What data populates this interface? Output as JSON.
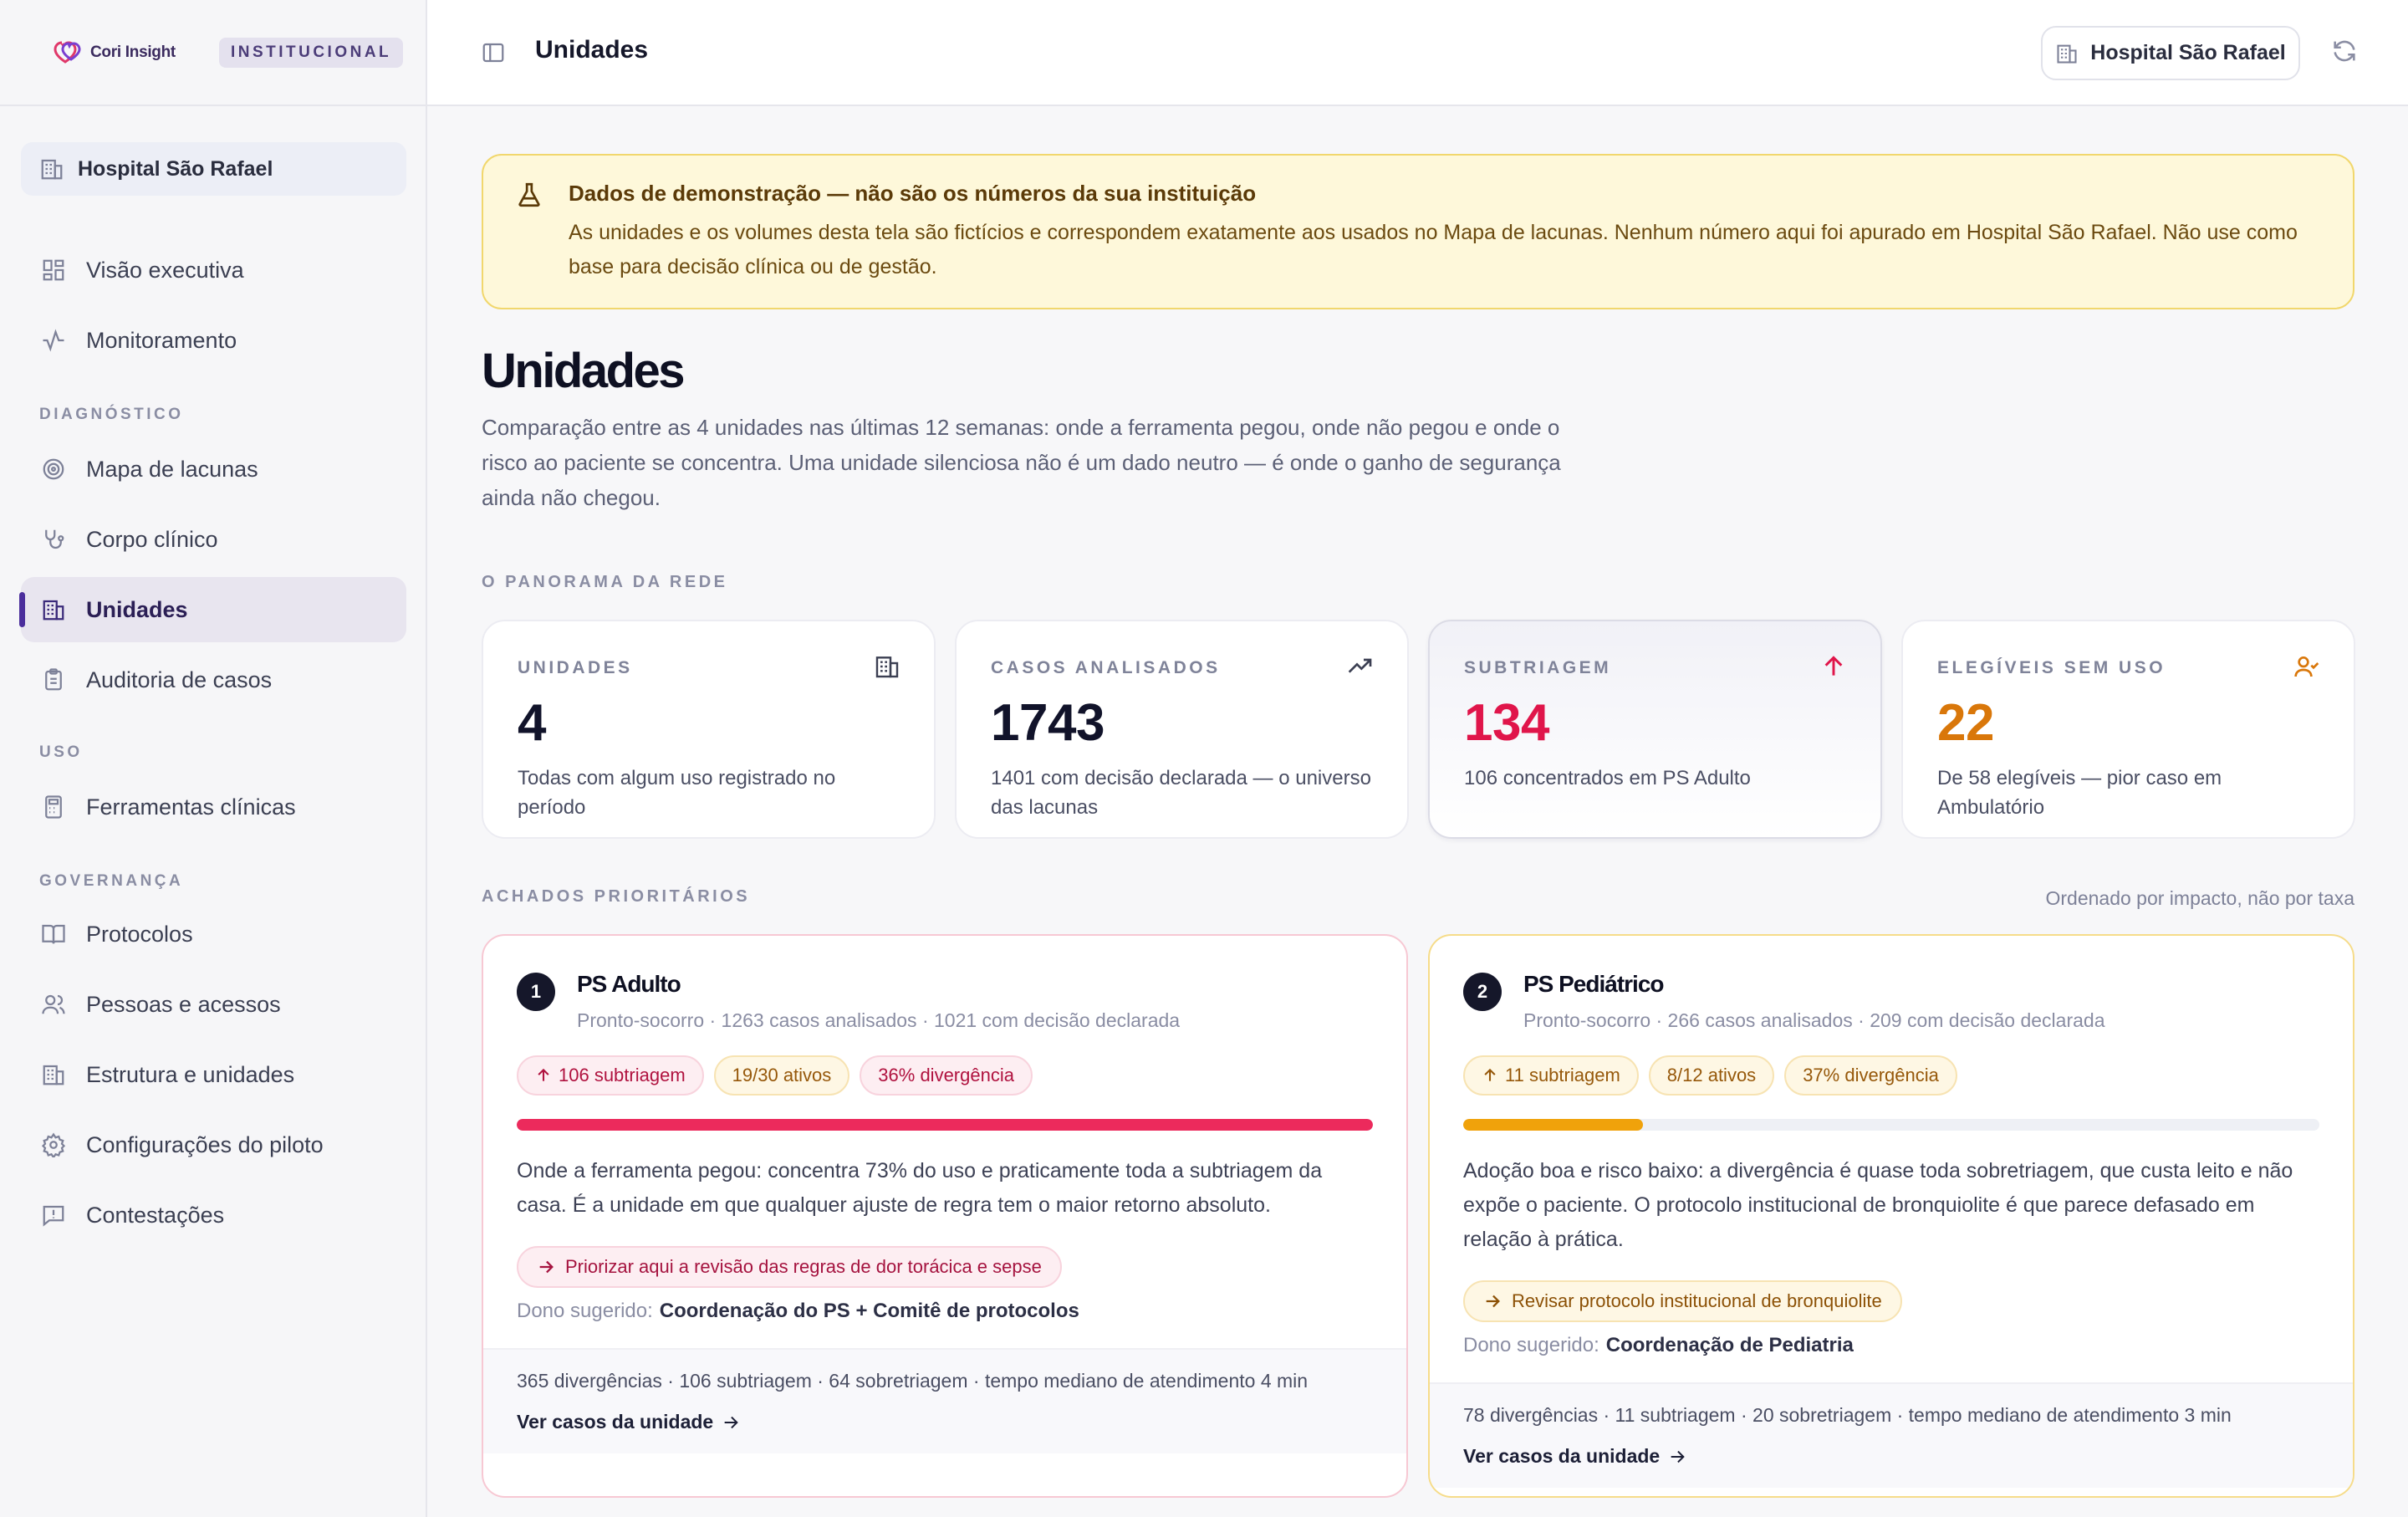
{
  "brand": {
    "name": "Cori Insight",
    "badge": "INSTITUCIONAL"
  },
  "sidebar": {
    "hospital": "Hospital São Rafael",
    "items": [
      {
        "label": "Visão executiva",
        "icon": "grid-icon"
      },
      {
        "label": "Monitoramento",
        "icon": "activity-icon"
      },
      {
        "label": "Mapa de lacunas",
        "icon": "target-icon"
      },
      {
        "label": "Corpo clínico",
        "icon": "stethoscope-icon"
      },
      {
        "label": "Unidades",
        "icon": "building-icon",
        "active": true
      },
      {
        "label": "Auditoria de casos",
        "icon": "clipboard-icon"
      },
      {
        "label": "Ferramentas clínicas",
        "icon": "calculator-icon"
      },
      {
        "label": "Protocolos",
        "icon": "book-icon"
      },
      {
        "label": "Pessoas e acessos",
        "icon": "users-icon"
      },
      {
        "label": "Estrutura e unidades",
        "icon": "building-icon"
      },
      {
        "label": "Configurações do piloto",
        "icon": "gear-icon"
      },
      {
        "label": "Contestações",
        "icon": "message-alert-icon"
      }
    ],
    "sections": {
      "diagnostico": "DIAGNÓSTICO",
      "uso": "USO",
      "governanca": "GOVERNANÇA"
    }
  },
  "topbar": {
    "title": "Unidades",
    "hospital_button": "Hospital São Rafael"
  },
  "banner": {
    "title": "Dados de demonstração — não são os números da sua instituição",
    "text": "As unidades e os volumes desta tela são fictícios e correspondem exatamente aos usados no Mapa de lacunas. Nenhum número aqui foi apurado em Hospital São Rafael. Não use como base para decisão clínica ou de gestão."
  },
  "page": {
    "title": "Unidades",
    "description": "Comparação entre as 4 unidades nas últimas 12 semanas: onde a ferramenta pegou, onde não pegou e onde o risco ao paciente se concentra. Uma unidade silenciosa não é um dado neutro — é onde o ganho de segurança ainda não chegou."
  },
  "panorama": {
    "label": "O PANORAMA DA REDE",
    "cards": [
      {
        "label": "UNIDADES",
        "value": "4",
        "desc": "Todas com algum uso registrado no período",
        "icon": "building-icon",
        "color": "#11132a"
      },
      {
        "label": "CASOS ANALISADOS",
        "value": "1743",
        "desc": "1401 com decisão declarada — o universo das lacunas",
        "icon": "trending-up-icon",
        "color": "#11132a"
      },
      {
        "label": "SUBTRIAGEM",
        "value": "134",
        "desc": "106 concentrados em PS Adulto",
        "icon": "arrow-up-icon",
        "color": "#e0154a"
      },
      {
        "label": "ELEGÍVEIS SEM USO",
        "value": "22",
        "desc": "De 58 elegíveis — pior caso em Ambulatório",
        "icon": "user-check-icon",
        "color": "#d9770a"
      }
    ]
  },
  "findings": {
    "label": "ACHADOS PRIORITÁRIOS",
    "sort_note": "Ordenado por impacto, não por taxa",
    "items": [
      {
        "rank": "1",
        "name": "PS Adulto",
        "meta": "Pronto-socorro · 1263 casos analisados · 1021 com decisão declarada",
        "chips": [
          "106 subtriagem",
          "19/30 ativos",
          "36% divergência"
        ],
        "bar_fraction": 1.0,
        "bar_color": "#ec2a5c",
        "text": "Onde a ferramenta pegou: concentra 73% do uso e praticamente toda a subtriagem da casa. É a unidade em que qualquer ajuste de regra tem o maior retorno absoluto.",
        "action": "Priorizar aqui a revisão das regras de dor torácica e sepse",
        "owner_label": "Dono sugerido:",
        "owner": "Coordenação do PS + Comitê de protocolos",
        "footer_stats": "365 divergências · 106 subtriagem · 64 sobretriagem · tempo mediano de atendimento 4 min",
        "link": "Ver casos da unidade"
      },
      {
        "rank": "2",
        "name": "PS Pediátrico",
        "meta": "Pronto-socorro · 266 casos analisados · 209 com decisão declarada",
        "chips": [
          "11 subtriagem",
          "8/12 ativos",
          "37% divergência"
        ],
        "bar_fraction": 0.21,
        "bar_color": "#f0a20b",
        "text": "Adoção boa e risco baixo: a divergência é quase toda sobretriagem, que custa leito e não expõe o paciente. O protocolo institucional de bronquiolite é que parece defasado em relação à prática.",
        "action": "Revisar protocolo institucional de bronquiolite",
        "owner_label": "Dono sugerido:",
        "owner": "Coordenação de Pediatria",
        "footer_stats": "78 divergências · 11 subtriagem · 20 sobretriagem · tempo mediano de atendimento 3 min",
        "link": "Ver casos da unidade"
      }
    ]
  }
}
